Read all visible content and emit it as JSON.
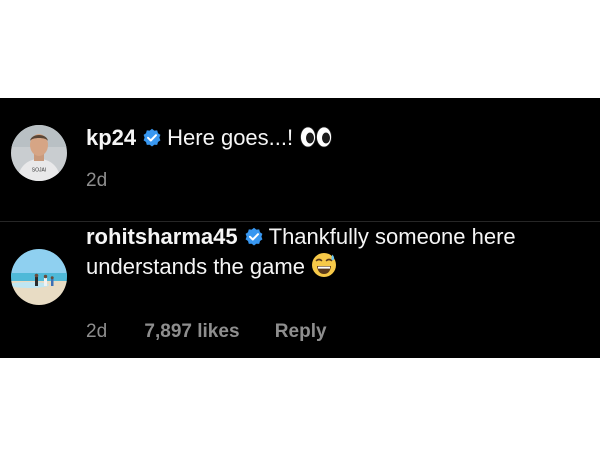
{
  "comments": [
    {
      "username": "kp24",
      "verified": true,
      "text": "Here goes...!",
      "emoji": "eyes-emoji",
      "age": "2d",
      "avatar_text": "SOJAI"
    },
    {
      "username": "rohitsharma45",
      "verified": true,
      "text_line1": "Thankfully someone here",
      "text_line2": "understands the game",
      "emoji": "grinning-sweat-emoji",
      "age": "2d",
      "likes": "7,897 likes",
      "reply_label": "Reply"
    }
  ],
  "colors": {
    "background": "#000000",
    "text": "#f5f5f5",
    "meta": "#8e8e8e",
    "verified_badge": "#3897f0"
  }
}
